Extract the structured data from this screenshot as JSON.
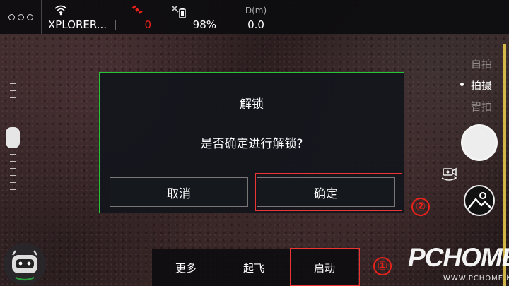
{
  "topbar": {
    "wifi_ssid": "XPLORER...",
    "satellites": "0",
    "battery": "98%",
    "distance_label": "D(m)",
    "distance_value": "0.0"
  },
  "modes": [
    "自拍",
    "拍摄",
    "智拍"
  ],
  "active_mode": "拍摄",
  "dialog": {
    "title": "解锁",
    "message": "是否确定进行解锁?",
    "cancel": "取消",
    "confirm": "确定"
  },
  "bottom": {
    "more": "更多",
    "takeoff": "起飞",
    "start": "启动"
  },
  "annotations": {
    "step1": "①",
    "step2": "②"
  },
  "watermark": {
    "main": "PCHOME",
    "sub": "WWW.PCHOME.NET"
  },
  "colors": {
    "satellite_red": "#e8221b",
    "dialog_border": "#27c43a",
    "highlight_red": "#e33",
    "edge_bar": "#e6c84c"
  },
  "icons": [
    "menu-icon",
    "wifi-icon",
    "satellite-icon",
    "battery-icon",
    "camera-switch-icon",
    "gallery-icon",
    "robot-avatar-icon"
  ]
}
